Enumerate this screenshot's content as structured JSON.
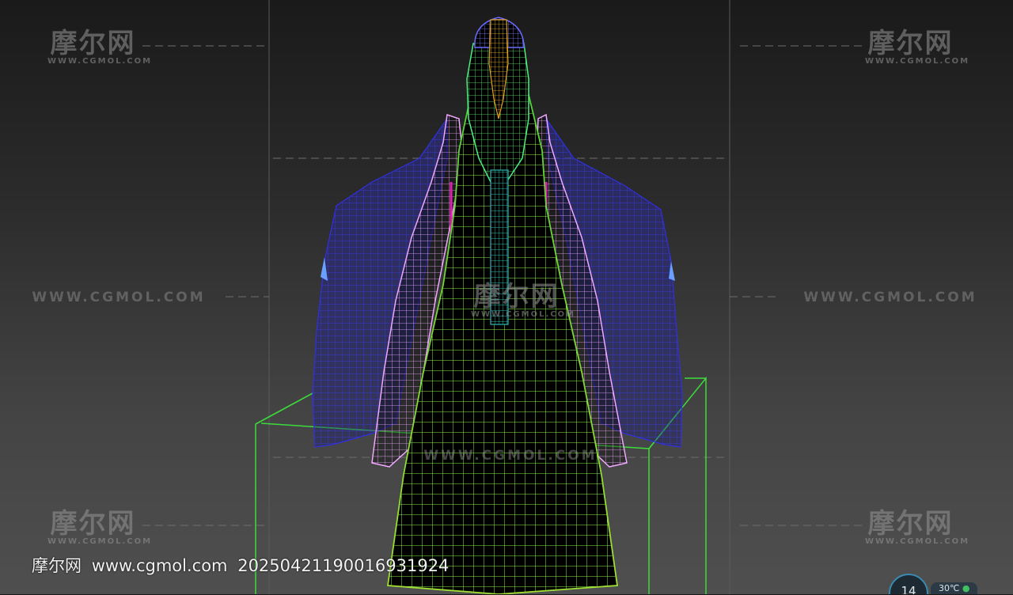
{
  "watermark": {
    "cn": "摩尔网",
    "url_small": "WWW.CGMOL.COM",
    "url_big": "WWW.CGMOL.COM"
  },
  "footer": {
    "site": "摩尔网",
    "url": "www.cgmol.com",
    "id": "20250421190016931924"
  },
  "widget": {
    "counter": "14",
    "temperature": "30℃"
  },
  "colors": {
    "dress": "#7cff3c",
    "sleeve_outer": "#2a2ad8",
    "sleeve_inner": "#e28ff2",
    "hair": "#e0a020",
    "head": "#6a6aff",
    "belt": "#27a0a0",
    "tassel": "#e020b0",
    "bbox": "#3cdc3c"
  }
}
